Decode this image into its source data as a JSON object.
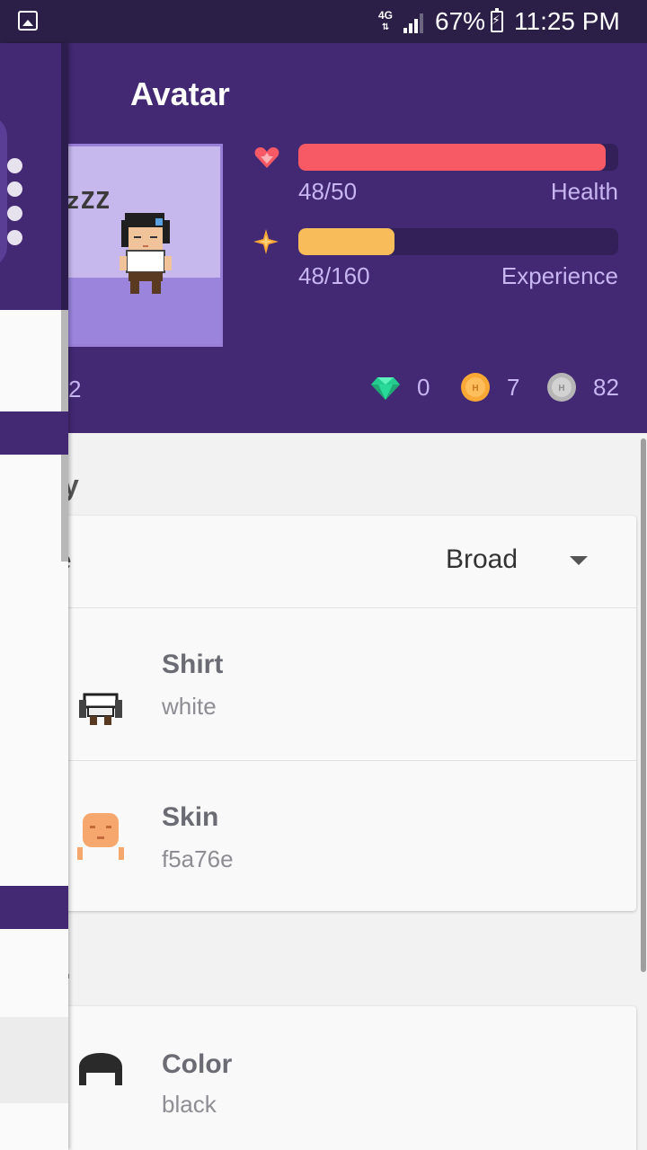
{
  "status_bar": {
    "network": "4G",
    "battery": "67%",
    "time": "11:25 PM"
  },
  "header": {
    "title": "Avatar",
    "avatar_zzz": "zZZ",
    "stats": {
      "health": {
        "value": "48/50",
        "label": "Health",
        "current": 48,
        "max": 50,
        "color": "#f75a64",
        "icon": "heart-icon"
      },
      "experience": {
        "value": "48/160",
        "label": "Experience",
        "current": 48,
        "max": 160,
        "color": "#f9bc5a",
        "icon": "star-icon"
      }
    },
    "level_partial": "2",
    "currency": {
      "gems": "0",
      "gold": "7",
      "hourglass": "82"
    }
  },
  "content": {
    "section_1_partial": "y",
    "body_select": {
      "label_partial": "e",
      "value": "Broad"
    },
    "items": [
      {
        "title": "Shirt",
        "value": "white",
        "icon": "shirt-icon"
      },
      {
        "title": "Skin",
        "value": "f5a76e",
        "icon": "skin-icon"
      }
    ],
    "section_2_partial": ".",
    "hair": {
      "title": "Color",
      "value": "black",
      "icon": "hair-icon"
    }
  },
  "colors": {
    "primary": "#432874",
    "status_bar": "#2b1f47",
    "health": "#f75a64",
    "experience": "#f9bc5a"
  }
}
